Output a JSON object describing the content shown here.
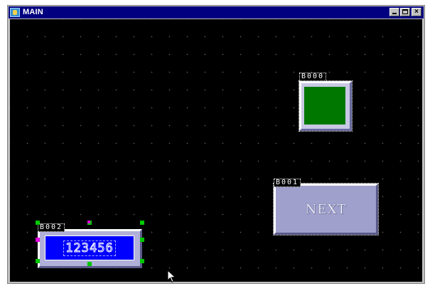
{
  "window": {
    "title": "MAIN",
    "controls": {
      "minimize": "_",
      "maximize": "□",
      "close": "×"
    }
  },
  "canvas": {
    "background": "#000000",
    "grid_dot_color": "#5a5a5a"
  },
  "widgets": [
    {
      "id": "B000",
      "type": "lamp",
      "face_color": "#007800"
    },
    {
      "id": "B001",
      "type": "button",
      "label": "NEXT",
      "face_color": "#a0a0cc"
    },
    {
      "id": "B002",
      "type": "numeric-display",
      "value": "123456",
      "face_color": "#0000ff",
      "selected": true
    }
  ],
  "cursor": {
    "icon": "arrow-pointer-icon"
  }
}
